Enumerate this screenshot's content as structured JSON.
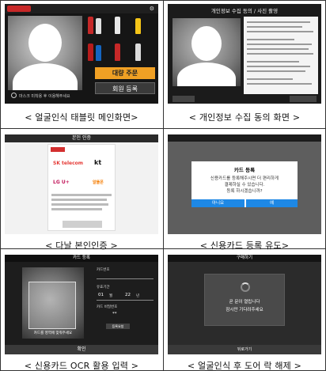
{
  "captions": {
    "c1": "< 얼굴인식 태블릿 메인화면>",
    "c2": "< 개인정보 수집 동의 화면 >",
    "c3": "< 다날 본인인증 >",
    "c4": "< 신용카드 등록 유도>",
    "c5": "< 신용카드 OCR 활용 입력 >",
    "c6": "< 얼굴인식 후 도어 락 해제 >"
  },
  "panel1": {
    "order_button": "대량 주문",
    "register_button": "회원 등록",
    "hint": "마스크 미착용 후 이용해주세요"
  },
  "panel2": {
    "title": "개인정보 수집 동의 / 사진 촬영"
  },
  "panel3": {
    "header": "본인 인증",
    "carriers": [
      "SK telecom",
      "kt",
      "LG U+",
      "알뜰폰"
    ]
  },
  "panel4": {
    "title": "카드 등록",
    "message_line1": "신용카드를 등록해주시면 더 편리하게",
    "message_line2": "결제하실 수 있습니다.",
    "message_line3": "등록 하시겠습니까?",
    "no_button": "아니요",
    "yes_button": "예"
  },
  "panel5": {
    "header": "카드 등록",
    "card_number_label": "카드번호",
    "expiry_label": "유효기간",
    "expiry_month": "01",
    "month_unit": "월",
    "expiry_year": "22",
    "year_unit": "년",
    "password_label": "카드 비밀번호",
    "password_value": "**",
    "scan_message": "카드를 영역에 맞춰주세요",
    "register_button": "등록요청",
    "confirm_button": "확인"
  },
  "panel6": {
    "header": "구매하기",
    "message_line1": "곧 문이 열립니다",
    "message_line2": "잠시만 기다려주세요",
    "back_button": "뒤로가기"
  }
}
